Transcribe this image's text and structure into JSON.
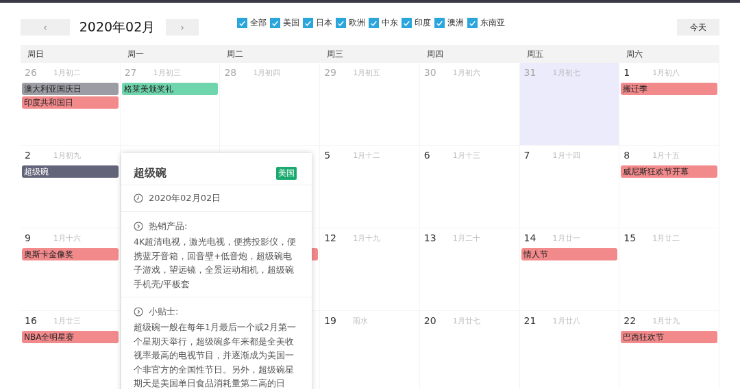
{
  "toolbar": {
    "prev": "‹",
    "title": "2020年02月",
    "next": "›",
    "today": "今天"
  },
  "filters": [
    {
      "label": "全部",
      "checked": true
    },
    {
      "label": "美国",
      "checked": true
    },
    {
      "label": "日本",
      "checked": true
    },
    {
      "label": "欧洲",
      "checked": true
    },
    {
      "label": "中东",
      "checked": true
    },
    {
      "label": "印度",
      "checked": true
    },
    {
      "label": "澳洲",
      "checked": true
    },
    {
      "label": "东南亚",
      "checked": true
    }
  ],
  "weekdays": [
    "周日",
    "周一",
    "周二",
    "周三",
    "周四",
    "周五",
    "周六"
  ],
  "weeks": [
    [
      {
        "day": "26",
        "lunar": "1月初二",
        "muted": true,
        "today": false,
        "events": [
          {
            "title": "澳大利亚国庆日",
            "color": "#9c9da4"
          },
          {
            "title": "印度共和国日",
            "color": "#f28a8c"
          }
        ]
      },
      {
        "day": "27",
        "lunar": "1月初三",
        "muted": true,
        "today": false,
        "events": [
          {
            "title": "格莱美颁奖礼",
            "color": "#6fd5ad"
          }
        ]
      },
      {
        "day": "28",
        "lunar": "1月初四",
        "muted": true,
        "today": false
      },
      {
        "day": "29",
        "lunar": "1月初五",
        "muted": true,
        "today": false
      },
      {
        "day": "30",
        "lunar": "1月初六",
        "muted": true,
        "today": false
      },
      {
        "day": "31",
        "lunar": "1月初七",
        "muted": true,
        "today": true
      },
      {
        "day": "1",
        "lunar": "1月初八",
        "muted": false,
        "today": false,
        "events": [
          {
            "title": "搬迁季",
            "color": "#f28a8c"
          }
        ]
      }
    ],
    [
      {
        "day": "2",
        "lunar": "1月初九",
        "muted": false,
        "today": false,
        "events": [
          {
            "title": "超级碗",
            "color": "#62647a"
          }
        ]
      },
      {
        "day": "5",
        "lunar": "1月十二",
        "muted": false,
        "today": false
      },
      {
        "day": "6",
        "lunar": "1月十三",
        "muted": false,
        "today": false
      },
      {
        "day": "7",
        "lunar": "1月十四",
        "muted": false,
        "today": false
      },
      {
        "day": "8",
        "lunar": "1月十五",
        "muted": false,
        "today": false,
        "events": [
          {
            "title": "威尼斯狂欢节开幕",
            "color": "#f28a8c"
          }
        ]
      }
    ],
    [
      {
        "day": "9",
        "lunar": "1月十六",
        "muted": false,
        "today": false,
        "events": [
          {
            "title": "奥斯卡金像奖",
            "color": "#f28a8c"
          }
        ]
      },
      {
        "events": [
          {
            "color": "#f28a8c"
          }
        ]
      },
      {
        "day": "12",
        "lunar": "1月十九",
        "muted": false,
        "today": false
      },
      {
        "day": "13",
        "lunar": "1月二十",
        "muted": false,
        "today": false
      },
      {
        "day": "14",
        "lunar": "1月廿一",
        "muted": false,
        "today": false,
        "events": [
          {
            "title": "情人节",
            "color": "#f28a8c"
          }
        ]
      },
      {
        "day": "15",
        "lunar": "1月廿二",
        "muted": false,
        "today": false
      }
    ],
    [
      {
        "day": "16",
        "lunar": "1月廿三",
        "muted": false,
        "today": false,
        "events": [
          {
            "title": "NBA全明星赛",
            "color": "#f28a8c"
          }
        ]
      },
      {
        "day": "19",
        "lunar": "雨水",
        "muted": false,
        "today": false
      },
      {
        "day": "20",
        "lunar": "1月廿七",
        "muted": false,
        "today": false
      },
      {
        "day": "21",
        "lunar": "1月廿八",
        "muted": false,
        "today": false
      },
      {
        "day": "22",
        "lunar": "1月廿九",
        "muted": false,
        "today": false,
        "events": [
          {
            "title": "巴西狂欢节",
            "color": "#f28a8c"
          }
        ]
      }
    ]
  ],
  "popup": {
    "title": "超级碗",
    "tag": "美国",
    "date": "2020年02月02日",
    "sections": [
      {
        "heading": "热销产品:",
        "text": "4K超清电视，激光电视，便携投影仪，便携蓝牙音箱，回音壁+低音炮，超级碗电子游戏，望远镜，全景运动相机，超级碗手机壳/平板套"
      },
      {
        "heading": "小贴士:",
        "text": "超级碗一般在每年1月最后一个或2月第一个星期天举行，超级碗多年来都是全美收视率最高的电视节目，并逐渐成为美国一个非官方的全国性节日。另外，超级碗星期天是美国单日食品消耗量第二高的日"
      }
    ]
  }
}
